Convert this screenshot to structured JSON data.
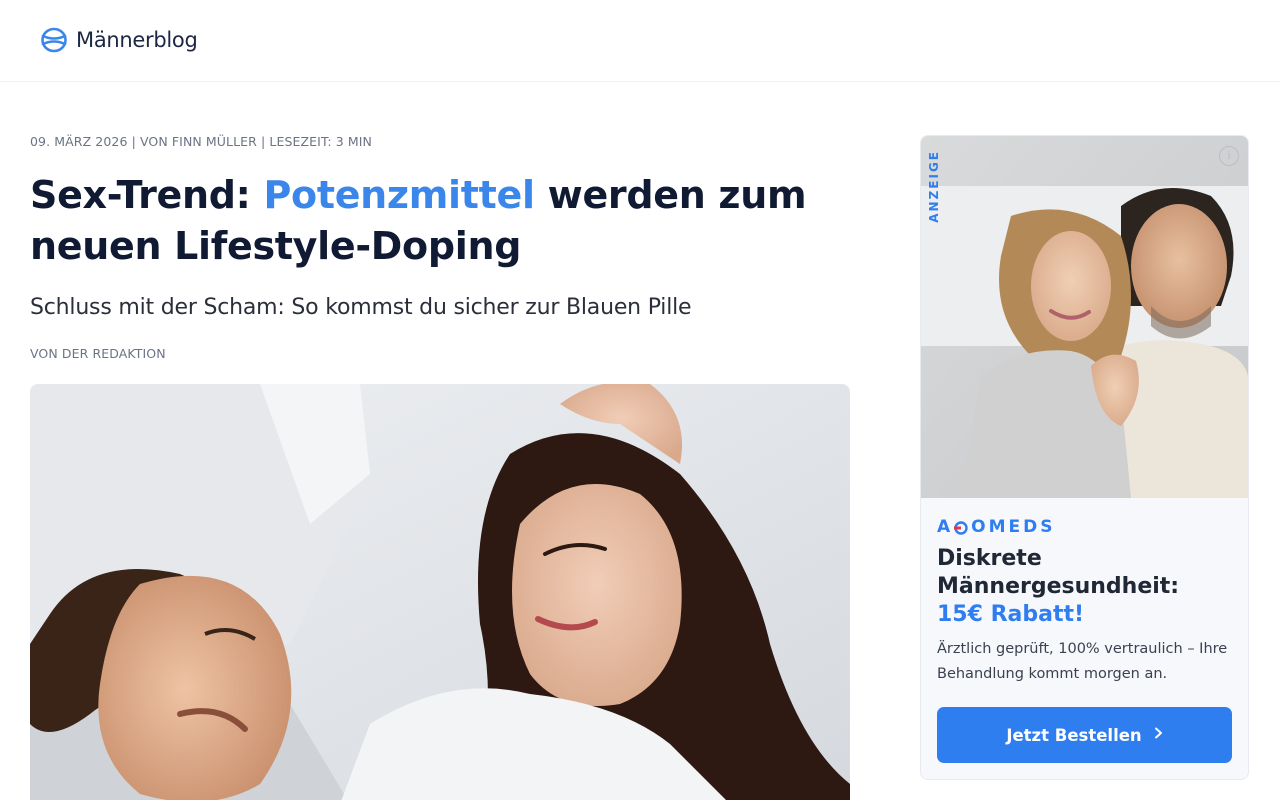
{
  "site": {
    "name": "Männerblog"
  },
  "article": {
    "meta": "09. MÄRZ 2026 | VON FINN MÜLLER | LESEZEIT: 3 MIN",
    "headline_before": "Sex-Trend: ",
    "headline_accent": "Potenzmittel",
    "headline_after": " werden zum neuen Lifestyle-Doping",
    "subheadline": "Schluss mit der Scham: So kommst du sicher zur Blauen Pille",
    "byline": "VON DER REDAKTION",
    "hero_image": "couple-in-bed-photo"
  },
  "ad": {
    "label": "ANZEIGE",
    "info_icon": "info-icon",
    "image": "couple-in-bed-photo",
    "brand_part1": "A",
    "brand_part2": "OMEDS",
    "title_line": "Diskrete Männergesundheit:",
    "title_accent": "15€ Rabatt!",
    "description": "Ärztlich geprüft, 100% vertraulich – Ihre Behandlung kommt morgen an.",
    "cta_label": "Jetzt Bestellen",
    "cta_icon": "chevron-right-icon"
  },
  "colors": {
    "accent": "#3b86ea",
    "ad_blue": "#2f7ef0",
    "ad_red": "#e0374a",
    "text_dark": "#111a33"
  }
}
